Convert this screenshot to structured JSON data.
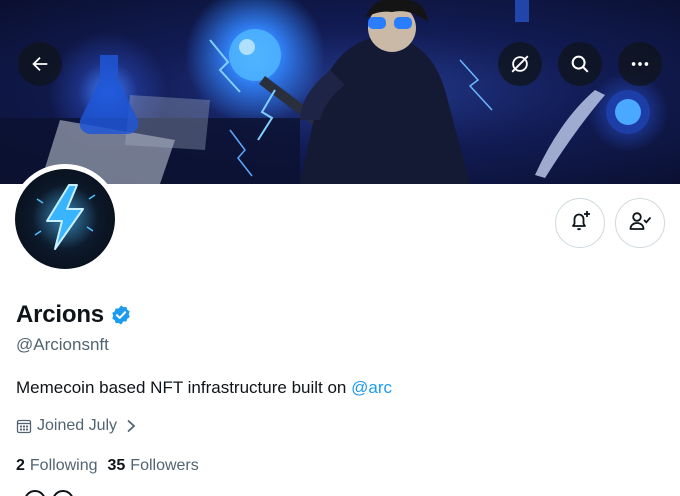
{
  "header": {
    "back_icon": "arrow-left-icon",
    "actions": [
      {
        "name": "unmute-icon"
      },
      {
        "name": "search-icon"
      },
      {
        "name": "more-icon"
      }
    ]
  },
  "profile": {
    "display_name": "Arcions",
    "handle": "@Arcionsnft",
    "verified": true,
    "bio_text": "Memecoin based NFT infrastructure built on ",
    "bio_mention": "@arc",
    "joined": "Joined July",
    "following_count": "2",
    "following_label": "Following",
    "followers_count": "35",
    "followers_label": "Followers"
  },
  "colors": {
    "accent": "#1d9bf0",
    "secondary_text": "#536471",
    "primary_text": "#0f1419",
    "border": "#cfd9de"
  }
}
